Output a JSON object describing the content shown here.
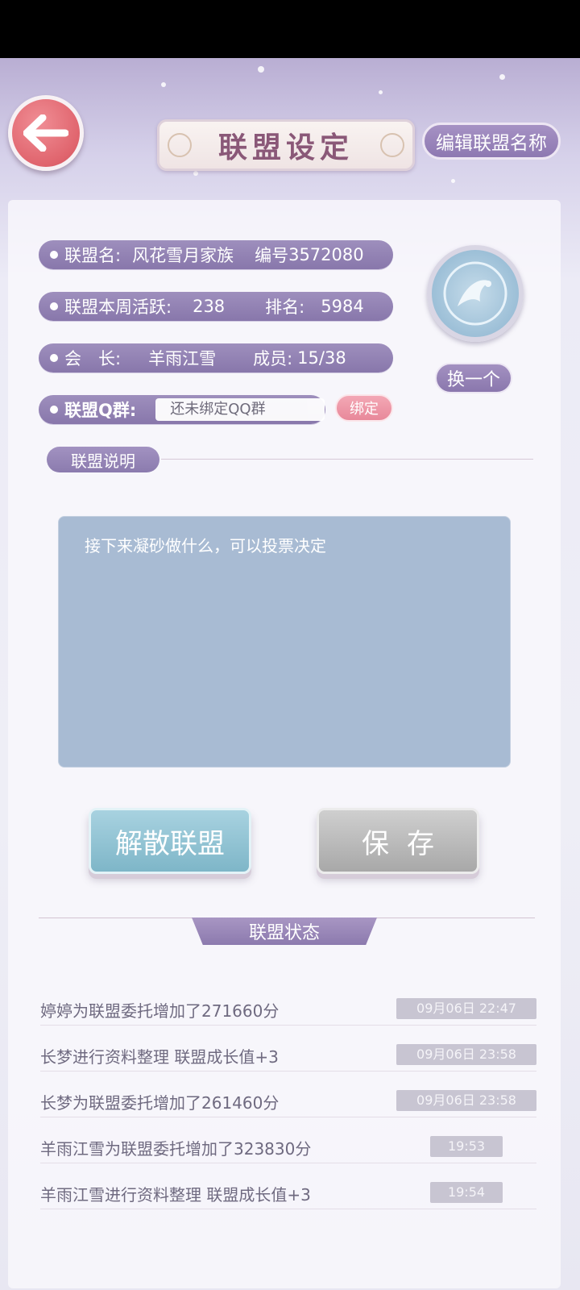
{
  "header": {
    "title": "联盟设定",
    "edit_name_label": "编辑联盟名称"
  },
  "info": {
    "name_label": "联盟名:",
    "name_value": "风花雪月家族",
    "id_label": "编号",
    "id_value": "3572080",
    "activity_label": "联盟本周活跃:",
    "activity_value": "238",
    "rank_label": "排名:",
    "rank_value": "5984",
    "leader_label": "会　长:",
    "leader_value": "羊雨江雪",
    "members_label": "成员:",
    "members_value": "15/38",
    "qq_label": "联盟Q群:",
    "qq_value": "还未绑定QQ群",
    "bind_label": "绑定"
  },
  "emblem": {
    "change_label": "换一个"
  },
  "description": {
    "section_label": "联盟说明",
    "text": "接下来凝砂做什么，可以投票决定"
  },
  "actions": {
    "dissolve_label": "解散联盟",
    "save_label": "保存"
  },
  "status": {
    "section_label": "联盟状态",
    "logs": [
      {
        "text": "婷婷为联盟委托增加了271660分",
        "time": "09月06日 22:47"
      },
      {
        "text": "长梦进行资料整理 联盟成长值+3",
        "time": "09月06日 23:58"
      },
      {
        "text": "长梦为联盟委托增加了261460分",
        "time": "09月06日 23:58"
      },
      {
        "text": "羊雨江雪为联盟委托增加了323830分",
        "time": "19:53"
      },
      {
        "text": "羊雨江雪进行资料整理 联盟成长值+3",
        "time": "19:54"
      }
    ]
  },
  "colors": {
    "accent_purple": "#8d78b1",
    "back_red": "#e0646d",
    "desc_blue": "#a8bbd3",
    "pink": "#e8889a"
  }
}
